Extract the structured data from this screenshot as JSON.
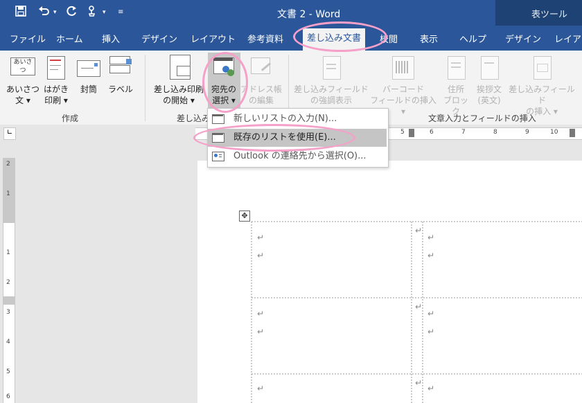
{
  "window": {
    "title": "文書 2  -  Word",
    "tool_context_title": "表ツール"
  },
  "tabs": [
    {
      "label": "ファイル"
    },
    {
      "label": "ホーム"
    },
    {
      "label": "挿入"
    },
    {
      "label": "デザイン"
    },
    {
      "label": "レイアウト"
    },
    {
      "label": "参考資料"
    },
    {
      "label": "差し込み文書",
      "active": true
    },
    {
      "label": "校閲"
    },
    {
      "label": "表示"
    },
    {
      "label": "ヘルプ"
    },
    {
      "label": "デザイン"
    },
    {
      "label": "レイアウ"
    }
  ],
  "ribbon": {
    "groups": {
      "create": "作成",
      "start_merge": "差し込み",
      "write_insert": "文章入力とフィールドの挿入"
    },
    "buttons": {
      "envelopes_jp": {
        "line1": "あいさつ",
        "line2": "文 ▾",
        "icon_text": "あいさつ"
      },
      "postcard": {
        "line1": "はがき",
        "line2": "印刷 ▾"
      },
      "envelope": {
        "line1": "封筒"
      },
      "labels": {
        "line1": "ラベル"
      },
      "start_mail_merge": {
        "line1": "差し込み印刷",
        "line2": "の開始 ▾"
      },
      "select_recipients": {
        "line1": "宛先の",
        "line2": "選択 ▾"
      },
      "edit_list": {
        "line1": "アドレス帳",
        "line2": "の編集"
      },
      "highlight_fields": {
        "line1": "差し込みフィールド",
        "line2": "の強調表示"
      },
      "barcode": {
        "line1": "バーコード",
        "line2": "フィールドの挿入 ▾"
      },
      "address_block": {
        "line1": "住所",
        "line2": "ブロック"
      },
      "greeting": {
        "line1": "挨拶文",
        "line2": "(英文)"
      },
      "insert_field": {
        "line1": "差し込みフィールド",
        "line2": "の挿入 ▾"
      }
    }
  },
  "dropdown": {
    "items": [
      {
        "label": "新しいリストの入力(N)..."
      },
      {
        "label": "既存のリストを使用(E)...",
        "highlighted": true
      },
      {
        "label": "Outlook の連絡先から選択(O)..."
      }
    ]
  },
  "ruler": {
    "h_ticks": [
      "5",
      "6",
      "7",
      "8",
      "9",
      "10"
    ],
    "v_ticks": [
      "2",
      "1",
      "1",
      "2",
      "3",
      "4",
      "5",
      "6"
    ]
  },
  "document": {
    "paragraph_mark": "↵",
    "end_of_cell_mark": "↵"
  },
  "colors": {
    "title_bar": "#2b579a",
    "highlight_circle": "#f5a0c8",
    "menu_hover": "#c5c5c5"
  }
}
